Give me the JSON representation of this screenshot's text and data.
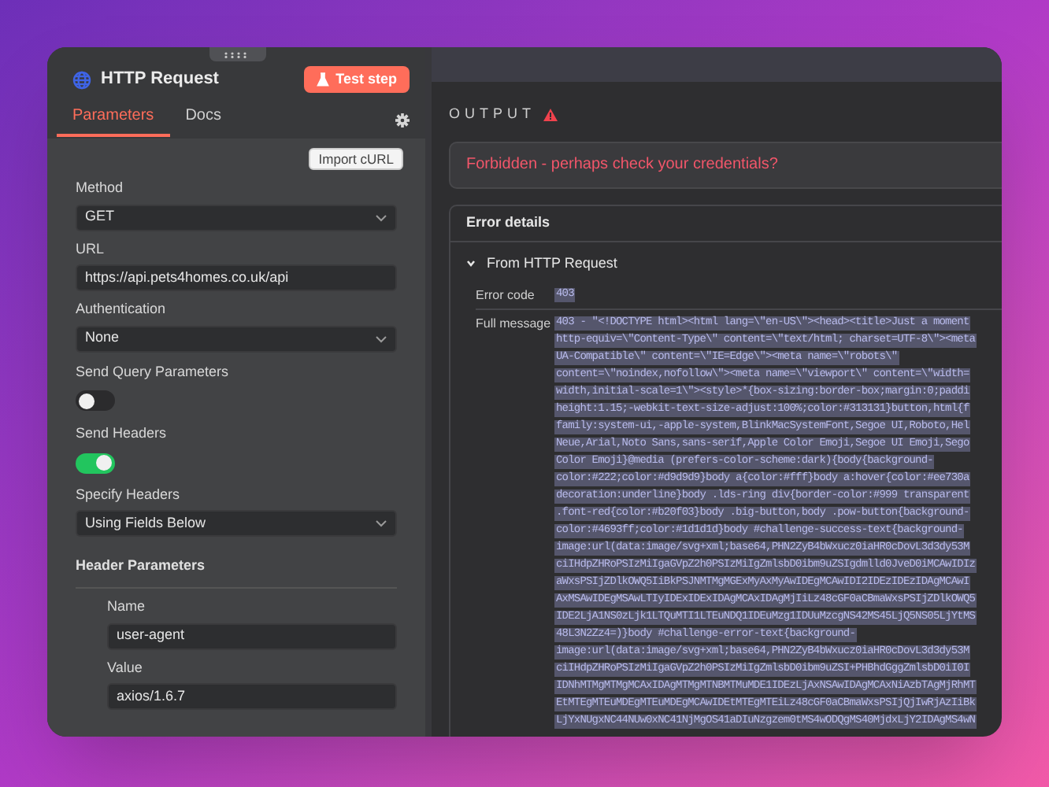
{
  "panel": {
    "title": "HTTP Request",
    "test_button": "Test step",
    "tabs": [
      {
        "label": "Parameters",
        "selected": true
      },
      {
        "label": "Docs",
        "selected": false
      }
    ],
    "import_button": "Import cURL",
    "fields": [
      {
        "kind": "select",
        "label": "Method",
        "value": "GET"
      },
      {
        "kind": "input",
        "label": "URL",
        "value": "https://api.pets4homes.co.uk/api"
      },
      {
        "kind": "select",
        "label": "Authentication",
        "value": "None"
      },
      {
        "kind": "toggle",
        "label": "Send Query Parameters",
        "on": false
      },
      {
        "kind": "toggle",
        "label": "Send Headers",
        "on": true
      },
      {
        "kind": "select",
        "label": "Specify Headers",
        "value": "Using Fields Below"
      }
    ],
    "header_parameters": {
      "title": "Header Parameters",
      "fields": [
        {
          "label": "Name",
          "value": "user-agent"
        },
        {
          "label": "Value",
          "value": "axios/1.6.7"
        }
      ]
    }
  },
  "output": {
    "title": "OUTPUT",
    "error": "Forbidden - perhaps check your credentials?",
    "details": {
      "title": "Error details",
      "section": {
        "title": "From HTTP Request",
        "expanded": true,
        "rows": [
          {
            "label": "Error code",
            "lines": [
              "403"
            ]
          },
          {
            "label": "Full message",
            "lines": [
              "403 - \"<!DOCTYPE html><html lang=\\\"en-US\\\"><head><title>Just a moment",
              "http-equiv=\\\"Content-Type\\\" content=\\\"text/html; charset=UTF-8\\\"><meta",
              "UA-Compatible\\\" content=\\\"IE=Edge\\\"><meta name=\\\"robots\\\"",
              "content=\\\"noindex,nofollow\\\"><meta name=\\\"viewport\\\" content=\\\"width=",
              "width,initial-scale=1\\\"><style>*{box-sizing:border-box;margin:0;paddi",
              "height:1.15;-webkit-text-size-adjust:100%;color:#313131}button,html{f",
              "family:system-ui,-apple-system,BlinkMacSystemFont,Segoe UI,Roboto,Hel",
              "Neue,Arial,Noto Sans,sans-serif,Apple Color Emoji,Segoe UI Emoji,Sego",
              "Color Emoji}@media (prefers-color-scheme:dark){body{background-",
              "color:#222;color:#d9d9d9}body a{color:#fff}body a:hover{color:#ee730a",
              "decoration:underline}body .lds-ring div{border-color:#999 transparent",
              ".font-red{color:#b20f03}body .big-button,body .pow-button{background-",
              "color:#4693ff;color:#1d1d1d}body #challenge-success-text{background-",
              "image:url(data:image/svg+xml;base64,PHN2ZyB4bWxucz0iaHR0cDovL3d3dy53M",
              "ciIHdpZHRoPSIzMiIgaGVpZ2h0PSIzMiIgZmlsbD0ibm9uZSIgdmlld0JveD0iMCAwIDIz",
              "aWxsPSIjZDlkOWQ5IiBkPSJNMTMgMGExMyAxMyAwIDEgMCAwIDI2IDEzIDEzIDAgMCAwI",
              "AxMSAwIDEgMSAwLTIyIDExIDExIDAgMCAxIDAgMjIiLz48cGF0aCBmaWxsPSIjZDlkOWQ5",
              "IDE2LjA1NS0zLjk1LTQuMTI1LTEuNDQ1IDEuMzg1IDUuMzcgNS42MS45LjQ5NS05LjYtMS",
              "48L3N2Zz4=)}body #challenge-error-text{background-",
              "image:url(data:image/svg+xml;base64,PHN2ZyB4bWxucz0iaHR0cDovL3d3dy53M",
              "ciIHdpZHRoPSIzMiIgaGVpZ2h0PSIzMiIgZmlsbD0ibm9uZSI+PHBhdGggZmlsbD0iI0I",
              "IDNhMTMgMTMgMCAxIDAgMTMgMTNBMTMuMDE1IDEzLjAxNSAwIDAgMCAxNiAzbTAgMjRhMT",
              "EtMTEgMTEuMDEgMTEuMDEgMCAwIDEtMTEgMTEiLz48cGF0aCBmaWxsPSIjQjIwRjAzIiBk",
              "LjYxNUgxNC44NUw0xNC41NjMgOS41aDIuNzgzem0tMS4wODQgMS40MjdxLjY2IDAgMS4wN"
            ]
          }
        ]
      }
    }
  }
}
